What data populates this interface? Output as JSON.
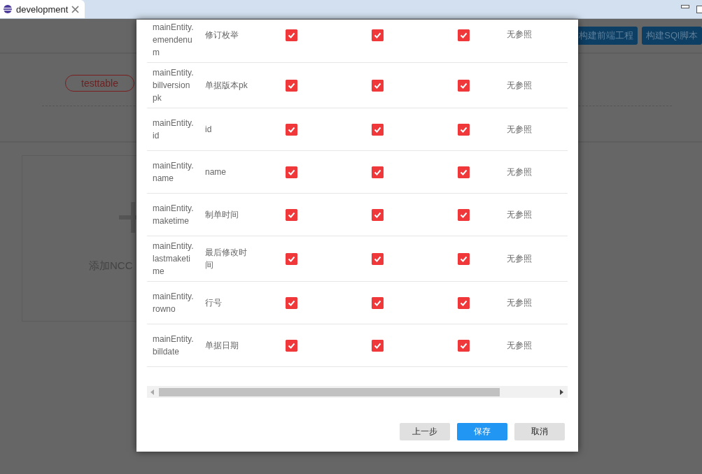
{
  "tab": {
    "label": "development",
    "selected": true
  },
  "background": {
    "toolbar_buttons": [
      "构建前端工程",
      "构建SQl脚本"
    ],
    "pill": "testtable",
    "card_text": "添加NCC"
  },
  "table": {
    "rows": [
      {
        "code": "mainEntity.emendenum",
        "name": "修订枚举",
        "checks": [
          true,
          true,
          true
        ],
        "ref": "无参照"
      },
      {
        "code": "mainEntity.billversionpk",
        "name": "单据版本pk",
        "checks": [
          true,
          true,
          true
        ],
        "ref": "无参照"
      },
      {
        "code": "mainEntity.id",
        "name": "id",
        "checks": [
          true,
          true,
          true
        ],
        "ref": "无参照"
      },
      {
        "code": "mainEntity.name",
        "name": "name",
        "checks": [
          true,
          true,
          true
        ],
        "ref": "无参照"
      },
      {
        "code": "mainEntity.maketime",
        "name": "制单时间",
        "checks": [
          true,
          true,
          true
        ],
        "ref": "无参照"
      },
      {
        "code": "mainEntity.lastmaketime",
        "name": "最后修改时间",
        "checks": [
          true,
          true,
          true
        ],
        "ref": "无参照"
      },
      {
        "code": "mainEntity.rowno",
        "name": "行号",
        "checks": [
          true,
          true,
          true
        ],
        "ref": "无参照"
      },
      {
        "code": "mainEntity.billdate",
        "name": "单据日期",
        "checks": [
          true,
          true,
          true
        ],
        "ref": "无参照"
      }
    ]
  },
  "buttons": [
    {
      "label": "上一步",
      "kind": "default"
    },
    {
      "label": "保存",
      "kind": "primary"
    },
    {
      "label": "取消",
      "kind": "default"
    }
  ]
}
